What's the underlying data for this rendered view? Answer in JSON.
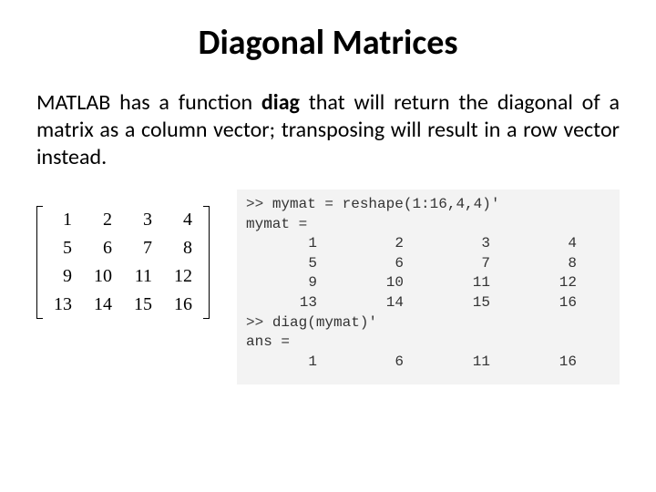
{
  "title": "Diagonal Matrices",
  "body": {
    "part1": "MATLAB  has  a  function  ",
    "bold": "diag",
    "part2": "  that  will return  the  diagonal   of  a  matrix  as a column  vector; transposing will result in a row vector instead."
  },
  "matrix": {
    "rows": [
      [
        "1",
        "2",
        "3",
        "4"
      ],
      [
        "5",
        "6",
        "7",
        "8"
      ],
      [
        "9",
        "10",
        "11",
        "12"
      ],
      [
        "13",
        "14",
        "15",
        "16"
      ]
    ]
  },
  "console": {
    "line1_prompt": ">> ",
    "line1_cmd": "mymat = reshape(1:16,4,4)'",
    "line2": "mymat =",
    "mat_rows": [
      [
        "1",
        "2",
        "3",
        "4"
      ],
      [
        "5",
        "6",
        "7",
        "8"
      ],
      [
        "9",
        "10",
        "11",
        "12"
      ],
      [
        "13",
        "14",
        "15",
        "16"
      ]
    ],
    "line3_prompt": ">> ",
    "line3_cmd": "diag(mymat)'",
    "line4": "ans =",
    "ans_row": [
      "1",
      "6",
      "11",
      "16"
    ]
  }
}
